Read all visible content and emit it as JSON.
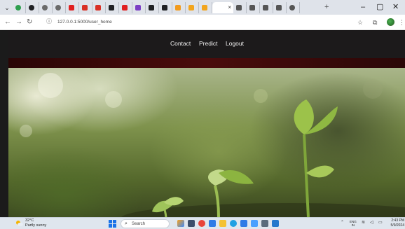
{
  "browser": {
    "tabs": [
      {
        "icon": "circle-icon",
        "color": "#2e9e4e"
      },
      {
        "icon": "openai-icon",
        "color": "#202124"
      },
      {
        "icon": "chat-icon",
        "color": "#6a6a6a"
      },
      {
        "icon": "chat-icon",
        "color": "#6a6a6a"
      },
      {
        "icon": "youtube-icon",
        "color": "#e02020"
      },
      {
        "icon": "gmail-icon",
        "color": "#d93025"
      },
      {
        "icon": "gmail-icon",
        "color": "#d93025"
      },
      {
        "icon": "notion-icon",
        "color": "#202124"
      },
      {
        "icon": "youtube-icon",
        "color": "#e02020"
      },
      {
        "icon": "purple-app-icon",
        "color": "#7b3fc4"
      },
      {
        "icon": "github-icon",
        "color": "#202124"
      },
      {
        "icon": "github-icon",
        "color": "#202124"
      },
      {
        "icon": "orange-app-icon",
        "color": "#f29b1e"
      },
      {
        "icon": "orange-app-icon",
        "color": "#f2a51e"
      },
      {
        "icon": "orange-app-icon",
        "color": "#f2a51e"
      },
      {
        "icon": "wikipedia-icon",
        "color": "#555555"
      },
      {
        "icon": "wikipedia-icon",
        "color": "#555555"
      },
      {
        "icon": "wikipedia-icon",
        "color": "#555555"
      },
      {
        "icon": "wikipedia-icon",
        "color": "#555555"
      },
      {
        "icon": "settings-icon",
        "color": "#555555"
      }
    ],
    "active_tab_close": "×",
    "new_tab": "+",
    "minimize": "–",
    "maximize": "▢",
    "close": "✕",
    "url": "127.0.0.1:5000/user_home"
  },
  "site": {
    "nav": [
      "Contact",
      "Predict",
      "Logout"
    ],
    "colors": {
      "nav_bg": "#1c1a1b",
      "stripe": "#4a0c0c"
    }
  },
  "taskbar": {
    "weather_temp": "32°C",
    "weather_desc": "Partly sunny",
    "search_placeholder": "Search",
    "lang_top": "ENG",
    "lang_bottom": "IN",
    "time": "2:43 PM",
    "date": "5/9/2024"
  }
}
